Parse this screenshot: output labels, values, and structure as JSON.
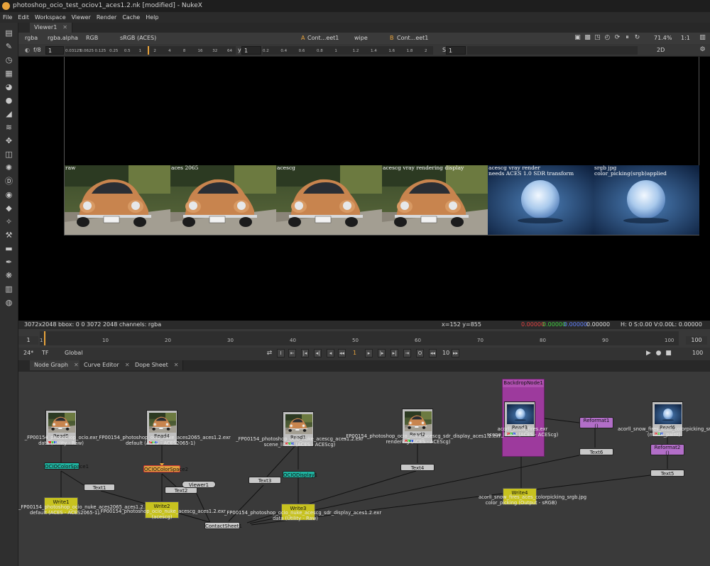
{
  "window": {
    "title": "photoshop_ocio_test_ociov1_aces1.2.nk [modified] - NukeX"
  },
  "menu": [
    "File",
    "Edit",
    "Workspace",
    "Viewer",
    "Render",
    "Cache",
    "Help"
  ],
  "viewer": {
    "tab_label": "Viewer1",
    "channels": "rgba",
    "alpha": "rgba.alpha",
    "colorspace_mode": "RGB",
    "view_transform": "sRGB (ACES)",
    "input_a_label": "A",
    "input_a_value": "Cont...eet1",
    "wipe": "wipe",
    "input_b_label": "B",
    "input_b_value": "Cont...eet1",
    "zoom": "71.4%",
    "proxy": "1:1",
    "fstop": "f/8",
    "gain": "1",
    "y_label": "y",
    "y_value": "1",
    "s_label": "S",
    "s_value": "1",
    "view_mode": "2D",
    "gain_ticks": [
      "0.03125",
      "0.0625",
      "0.125",
      "0.25",
      "0.5",
      "1",
      "2",
      "4",
      "8",
      "16",
      "32",
      "64"
    ],
    "gamma_ticks": [
      "0.2",
      "0.4",
      "0.6",
      "0.8",
      "1",
      "1.2",
      "1.4",
      "1.6",
      "1.8",
      "2"
    ],
    "tiles": [
      {
        "label": "raw",
        "type": "car"
      },
      {
        "label": "aces 2065",
        "type": "car"
      },
      {
        "label": "acescg",
        "type": "car"
      },
      {
        "label": "acescg vray rendering display",
        "type": "car"
      },
      {
        "label": "acescg vray render\nneeds ACES 1.0 SDR transform",
        "type": "snow"
      },
      {
        "label": "srgb jpg\ncolor_picking(srgb)applied",
        "type": "snow"
      }
    ]
  },
  "status": {
    "left": "3072x2048  bbox: 0 0 3072 2048 channels: rgba",
    "coords": "x=152 y=855",
    "r": "0.00000",
    "g": "0.00000",
    "b": "0.00000",
    "a": "0.00000",
    "hsv": "H:  0 S:0.00 V:0.00",
    "l": "L: 0.00000"
  },
  "timeline": {
    "start": "1",
    "end": "100",
    "ticks": [
      "1",
      "10",
      "20",
      "30",
      "40",
      "50",
      "60",
      "70",
      "80",
      "90",
      "100"
    ],
    "fps": "24*",
    "tf": "TF",
    "global": "Global",
    "current_frame": "1",
    "step": "10",
    "end_field": "100"
  },
  "panels": {
    "tabs": [
      "Node Graph",
      "Curve Editor",
      "Dope Sheet"
    ]
  },
  "nodes": {
    "read5": {
      "name": "Read5",
      "label": "_FP00154_photoshop_ocio.exr\ndata (Utility - Raw)"
    },
    "read4": {
      "name": "Read4",
      "label": "_FP00154_photoshop_ocio_nuke_aces2065_aces1.2.exr\ndefault (ACES - ACES2065-1)"
    },
    "read1": {
      "name": "Read1",
      "label": "_FP00154_photoshop_ocio_nuke_acescg_aces1.2.exr\nscene_linear (ACES - ACEScg)"
    },
    "read2": {
      "name": "Read2",
      "label": "_FP00154_photoshop_ocio_nuke_acescg_sdr_display_aces1.2.exr\nrendering (ACES - ACEScg)"
    },
    "read3": {
      "name": "Read3",
      "label": "acorll_snow_fires.exr\nscene_linear (ACES - ACEScg)"
    },
    "read6": {
      "name": "Read6",
      "label": "acorll_snow_fires_aces_colorpicking_srgb.jpg\n(matte_paint)"
    },
    "backdrop": {
      "name": "BackdropNode1"
    },
    "ociocs1": {
      "name": "OCIOColorSpace1"
    },
    "ociocs2": {
      "name": "OCIOColorSpace2"
    },
    "ociodisplay1": {
      "name": "OCIODisplay1"
    },
    "text1": {
      "name": "Text1"
    },
    "text2": {
      "name": "Text2"
    },
    "text3": {
      "name": "Text3"
    },
    "text4": {
      "name": "Text4"
    },
    "text5": {
      "name": "Text5"
    },
    "text6": {
      "name": "Text6"
    },
    "viewer1": {
      "name": "Viewer1"
    },
    "reformat1": {
      "name": "Reformat1",
      "sub": "()"
    },
    "reformat2": {
      "name": "Reformat2",
      "sub": "()"
    },
    "contactsheet": {
      "name": "ContactSheet1"
    },
    "write1": {
      "name": "Write1",
      "label": "_FP00154_photoshop_ocio_nuke_aces2065_aces1.2.exr\ndefault (ACES - ACES2065-1)"
    },
    "write2": {
      "name": "Write2",
      "label": "_FP00154_photoshop_ocio_nuke_acescg_aces1.2.exr\n(acescg)"
    },
    "write3": {
      "name": "Write3",
      "label": "_FP00154_photoshop_ocio_nuke_acescg_sdr_display_aces1.2.exr\ndata (Utility - Raw)"
    },
    "write4": {
      "name": "Write4",
      "label": "acorll_snow_fires_aces_colorpicking_srgb.jpg\ncolor_picking (Output - sRGB)"
    }
  },
  "colors": {
    "read": "#bfbfbf",
    "ocio": "#1fb3a0",
    "write": "#c7c21f",
    "reformat": "#b26ec8",
    "text": "#c8c8c8",
    "backdrop": "#9d3a9d",
    "ocio_cs2": "#e0a040"
  }
}
